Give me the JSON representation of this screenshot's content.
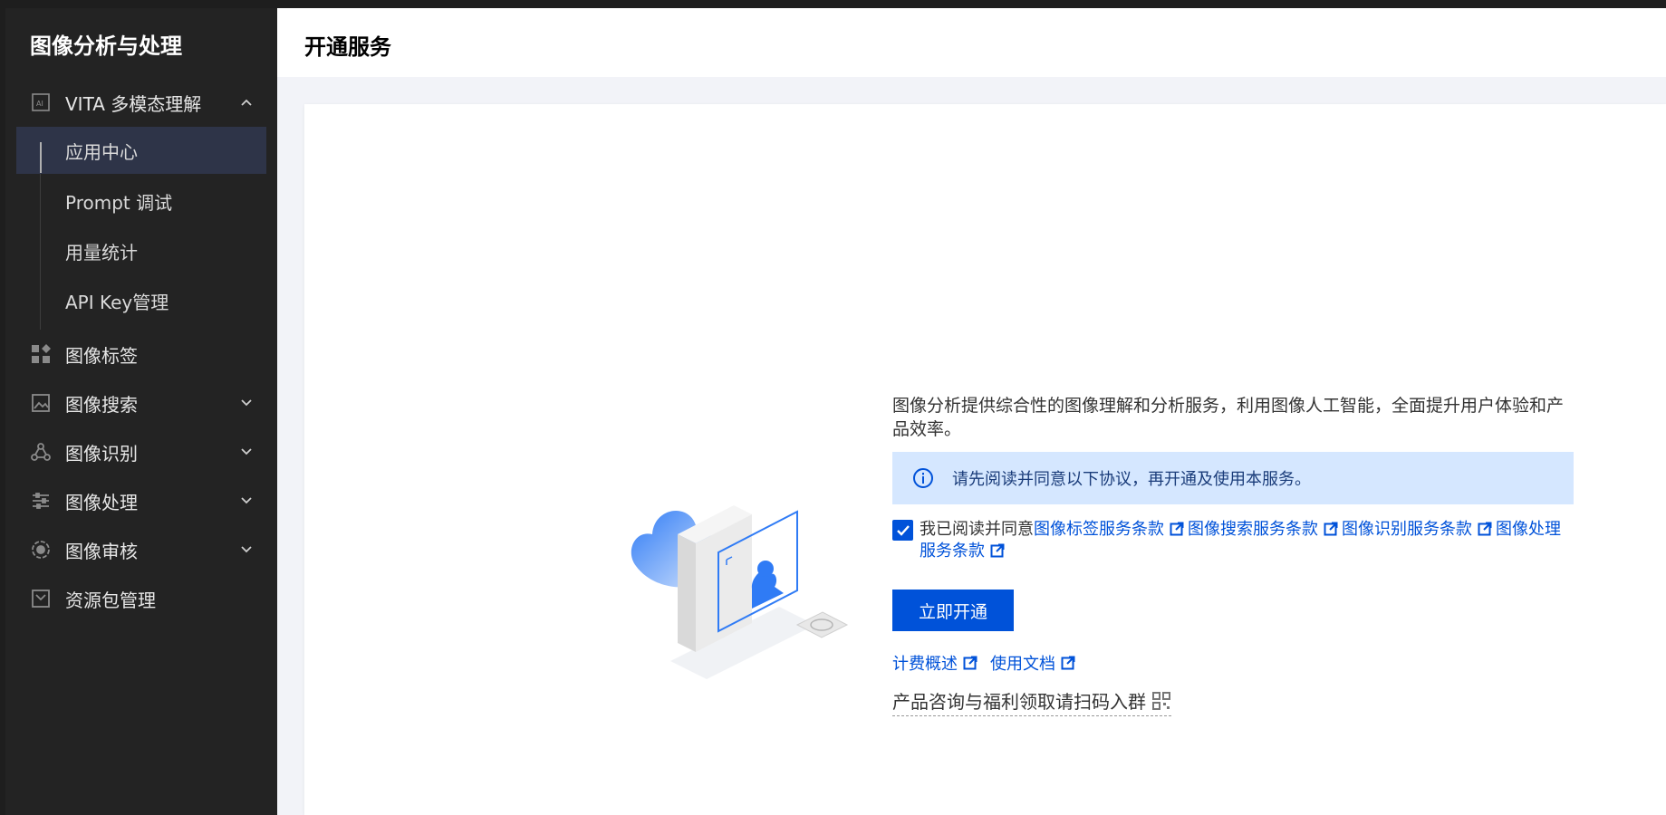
{
  "sidebar": {
    "app_title": "图像分析与处理",
    "items": [
      {
        "label": "VITA 多模态理解"
      },
      {
        "label": "图像标签"
      },
      {
        "label": "图像搜索"
      },
      {
        "label": "图像识别"
      },
      {
        "label": "图像处理"
      },
      {
        "label": "图像审核"
      },
      {
        "label": "资源包管理"
      }
    ],
    "sub_items": [
      {
        "label": "应用中心"
      },
      {
        "label": "Prompt 调试"
      },
      {
        "label": "用量统计"
      },
      {
        "label": "API Key管理"
      }
    ]
  },
  "header": {
    "title": "开通服务"
  },
  "main": {
    "description": "图像分析提供综合性的图像理解和分析服务，利用图像人工智能，全面提升用户体验和产品效率。",
    "notice": "请先阅读并同意以下协议，再开通及使用本服务。",
    "agree_prefix": "我已阅读并同意",
    "terms": [
      "图像标签服务条款",
      "图像搜索服务条款",
      "图像识别服务条款",
      "图像处理服务条款"
    ],
    "activate_button": "立即开通",
    "links": [
      "计费概述",
      "使用文档"
    ],
    "consult": "产品咨询与福利领取请扫码入群"
  },
  "colors": {
    "primary": "#0052d9",
    "sidebar_bg": "#232323",
    "notice_bg": "#d5e7ff"
  }
}
